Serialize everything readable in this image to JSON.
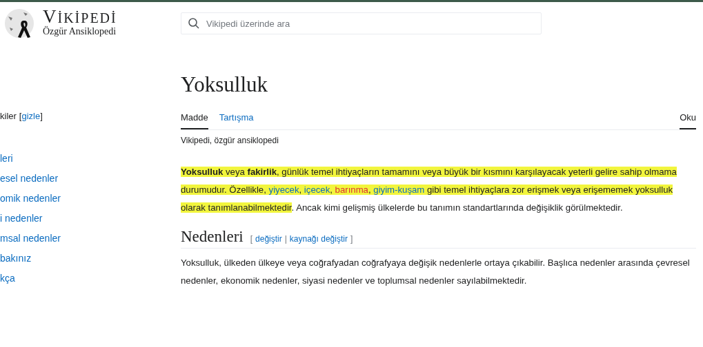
{
  "header": {
    "logo_title": "VİKİPEDİ",
    "logo_subtitle": "Özgür Ansiklopedi",
    "search": {
      "placeholder": "Vikipedi üzerinde ara"
    }
  },
  "toc": {
    "title": "kiler",
    "toggle_open": "[",
    "toggle": "gizle",
    "toggle_close": "]",
    "items": [
      {
        "label": "leri"
      },
      {
        "label": "esel nedenler"
      },
      {
        "label": "omik nedenler"
      },
      {
        "label": "i nedenler"
      },
      {
        "label": "msal nedenler"
      },
      {
        "label": "bakınız"
      },
      {
        "label": "kça"
      }
    ]
  },
  "article": {
    "title": "Yoksulluk",
    "tabs": [
      {
        "label": "Madde",
        "selected": true
      },
      {
        "label": "Tartışma",
        "selected": false
      }
    ],
    "view_tabs": [
      {
        "label": "Oku",
        "selected": true
      }
    ],
    "tagline": "Vikipedi, özgür ansiklopedi",
    "lead": {
      "highlighted": true,
      "highlighted_part": [
        {
          "kind": "bold",
          "text": "Yoksulluk"
        },
        {
          "kind": "plain",
          "text": " veya "
        },
        {
          "kind": "bold",
          "text": "fakirlik"
        },
        {
          "kind": "plain",
          "text": ", günlük temel ihtiyaçların tamamını veya büyük bir kısmını karşılayacak yeterli gelire sahip olmama durumudur. Özellikle, "
        },
        {
          "kind": "link",
          "text": "yiyecek"
        },
        {
          "kind": "plain",
          "text": ", "
        },
        {
          "kind": "link",
          "text": "içecek"
        },
        {
          "kind": "plain",
          "text": ", "
        },
        {
          "kind": "redlink",
          "text": "barınma"
        },
        {
          "kind": "plain",
          "text": ", "
        },
        {
          "kind": "link",
          "text": "giyim-kuşam"
        },
        {
          "kind": "plain",
          "text": " gibi temel ihtiyaçlara zor erişmek veya erişememek yoksulluk olarak tanımlanabilmektedir"
        }
      ],
      "rest": ". Ancak kimi gelişmiş ülkelerde bu tanımın standartlarında değişiklik görülmektedir."
    },
    "sections": [
      {
        "heading": "Nedenleri",
        "edit_open": "[",
        "edit": "değiştir",
        "separator": "|",
        "edit_source": "kaynağı değiştir",
        "edit_close": "]",
        "text": "Yoksulluk, ülkeden ülkeye veya coğrafyadan coğrafyaya değişik nedenlerle ortaya çıkabilir. Başlıca nedenler arasında çevresel nedenler, ekonomik nedenler, siyasi nedenler ve toplumsal nedenler sayılabilmektedir."
      }
    ]
  }
}
